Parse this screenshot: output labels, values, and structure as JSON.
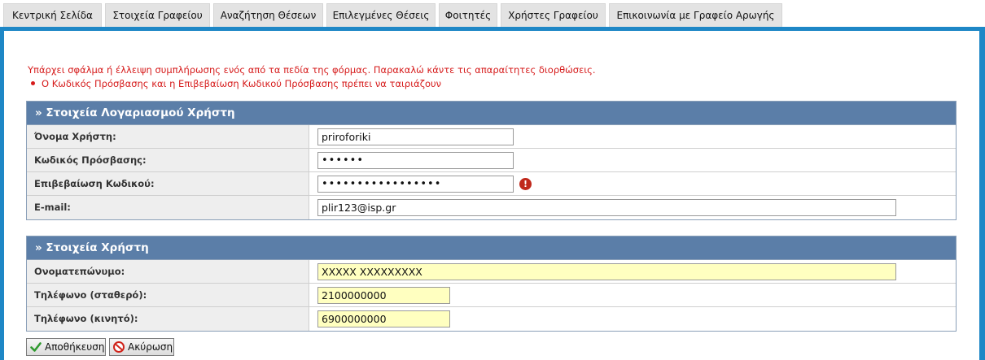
{
  "tabs": [
    {
      "label": "Κεντρική Σελίδα"
    },
    {
      "label": "Στοιχεία Γραφείου"
    },
    {
      "label": "Αναζήτηση Θέσεων"
    },
    {
      "label": "Επιλεγμένες Θέσεις"
    },
    {
      "label": "Φοιτητές"
    },
    {
      "label": "Χρήστες Γραφείου"
    },
    {
      "label": "Επικοινωνία με Γραφείο Αρωγής"
    }
  ],
  "error": {
    "message": "Υπάρχει σφάλμα ή έλλειψη συμπλήρωσης ενός από τα πεδία της φόρμας. Παρακαλώ κάντε τις απαραίτητες διορθώσεις.",
    "items": [
      "Ο Κωδικός Πρόσβασης και η Επιβεβαίωση Κωδικού Πρόσβασης πρέπει να ταιριάζουν"
    ]
  },
  "account": {
    "title": "» Στοιχεία Λογαριασμού Χρήστη",
    "username_label": "Όνομα Χρήστη:",
    "username_value": "priroforiki",
    "password_label": "Κωδικός Πρόσβασης:",
    "password_value": "••••••",
    "confirm_label": "Επιβεβαίωση Κωδικού:",
    "confirm_value": "•••••••••••••••••",
    "email_label": "E-mail:",
    "email_value": "plir123@isp.gr"
  },
  "user": {
    "title": "» Στοιχεία Χρήστη",
    "fullname_label": "Ονοματεπώνυμο:",
    "fullname_value": "XXXXX XXXXXXXXX",
    "phone_label": "Τηλέφωνο (σταθερό):",
    "phone_value": "2100000000",
    "mobile_label": "Τηλέφωνο (κινητό):",
    "mobile_value": "6900000000"
  },
  "buttons": {
    "save": "Αποθήκευση",
    "cancel": "Ακύρωση"
  },
  "colors": {
    "accent": "#1e87c6",
    "header": "#5b7ea8",
    "error": "#d61b1b",
    "highlight": "#ffffc0"
  },
  "icons": {
    "error_indicator": "exclamation-circle-icon",
    "save": "checkmark-icon",
    "cancel": "no-entry-icon"
  }
}
